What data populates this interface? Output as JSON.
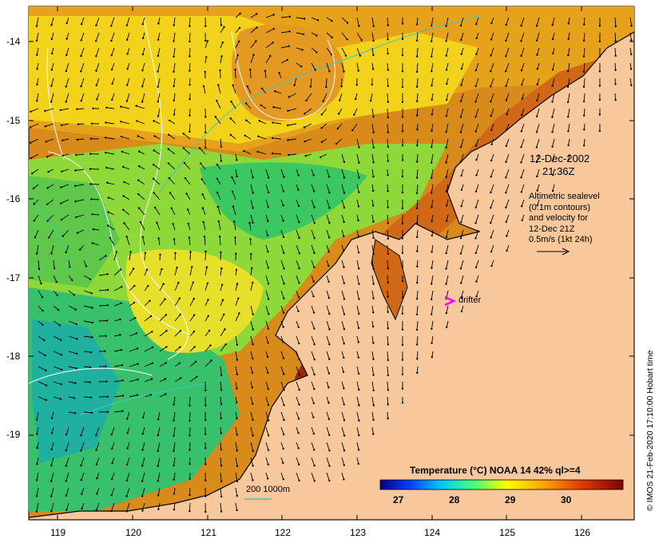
{
  "map": {
    "date_label": "12-Dec-2002",
    "time_label": "21:36Z",
    "info_lines": [
      "Altimetric sealevel",
      "(0.1m contours)",
      "and velocity for",
      "12-Dec 21Z",
      "0.5m/s (1kt 24h)"
    ],
    "drifter_label": "drifter",
    "depth_legend": "200  1000m",
    "copyright": "© IMOS 21-Feb-2020 17:10:00 Hobart time",
    "x_ticks": [
      "119",
      "120",
      "121",
      "122",
      "123",
      "124",
      "125",
      "126"
    ],
    "y_ticks": [
      "-14",
      "-15",
      "-16",
      "-17",
      "-18",
      "-19"
    ],
    "lon_range": [
      118.6,
      126.7
    ],
    "lat_range": [
      -20.1,
      -13.6
    ]
  },
  "colorbar": {
    "title": "Temperature (°C) NOAA 14 42% ql>=4",
    "ticks": [
      "27",
      "28",
      "29",
      "30"
    ],
    "range": [
      26.7,
      30.9
    ]
  },
  "colors": {
    "land": "#f7c89c",
    "coast": "#000000",
    "contour": "#ffffff",
    "isobath": "#40c8c0",
    "drifter": "#ff00ff",
    "arrow": "#000000"
  }
}
